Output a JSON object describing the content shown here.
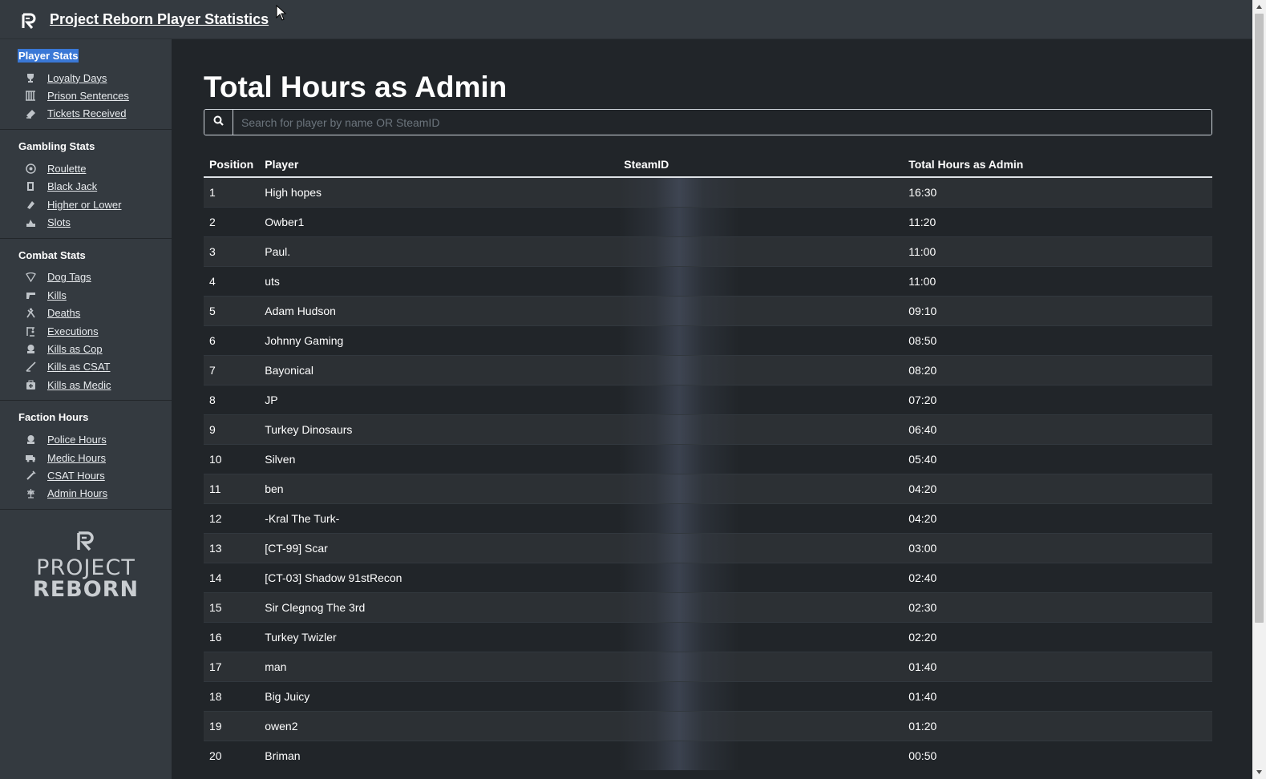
{
  "header": {
    "title": "Project Reborn Player Statistics",
    "logo_icon": "project-reborn-logo"
  },
  "sidebar": {
    "sections": [
      {
        "header": "Player Stats",
        "active": true,
        "items": [
          {
            "label": "Loyalty Days",
            "icon": "trophy-icon"
          },
          {
            "label": "Prison Sentences",
            "icon": "prison-bars-icon"
          },
          {
            "label": "Tickets Received",
            "icon": "ticket-icon"
          }
        ]
      },
      {
        "header": "Gambling Stats",
        "items": [
          {
            "label": "Roulette",
            "icon": "roulette-icon"
          },
          {
            "label": "Black Jack",
            "icon": "cards-icon"
          },
          {
            "label": "Higher or Lower",
            "icon": "dice-icon"
          },
          {
            "label": "Slots",
            "icon": "slot-machine-icon"
          }
        ]
      },
      {
        "header": "Combat Stats",
        "items": [
          {
            "label": "Dog Tags",
            "icon": "dog-tag-icon"
          },
          {
            "label": "Kills",
            "icon": "gun-icon"
          },
          {
            "label": "Deaths",
            "icon": "skull-icon"
          },
          {
            "label": "Executions",
            "icon": "execution-icon"
          },
          {
            "label": "Kills as Cop",
            "icon": "police-icon"
          },
          {
            "label": "Kills as CSAT",
            "icon": "rifle-icon"
          },
          {
            "label": "Kills as Medic",
            "icon": "medkit-icon"
          }
        ]
      },
      {
        "header": "Faction Hours",
        "items": [
          {
            "label": "Police Hours",
            "icon": "police-badge-icon"
          },
          {
            "label": "Medic Hours",
            "icon": "ambulance-icon"
          },
          {
            "label": "CSAT Hours",
            "icon": "sword-icon"
          },
          {
            "label": "Admin Hours",
            "icon": "admin-icon"
          }
        ]
      }
    ],
    "logo_text_line1": "PROJECT",
    "logo_text_line2": "REBORN"
  },
  "main": {
    "title": "Total Hours as Admin",
    "search": {
      "placeholder": "Search for player by name OR SteamID",
      "value": ""
    },
    "table": {
      "headers": [
        "Position",
        "Player",
        "SteamID",
        "Total Hours as Admin"
      ],
      "rows": [
        {
          "position": "1",
          "player": "High hopes",
          "hours": "16:30"
        },
        {
          "position": "2",
          "player": "Owber1",
          "hours": "11:20"
        },
        {
          "position": "3",
          "player": "Paul.",
          "hours": "11:00"
        },
        {
          "position": "4",
          "player": "uts",
          "hours": "11:00"
        },
        {
          "position": "5",
          "player": "Adam Hudson",
          "hours": "09:10"
        },
        {
          "position": "6",
          "player": "Johnny Gaming",
          "hours": "08:50"
        },
        {
          "position": "7",
          "player": "Bayonical",
          "hours": "08:20"
        },
        {
          "position": "8",
          "player": "JP",
          "hours": "07:20"
        },
        {
          "position": "9",
          "player": "Turkey Dinosaurs",
          "hours": "06:40"
        },
        {
          "position": "10",
          "player": "Silven",
          "hours": "05:40"
        },
        {
          "position": "11",
          "player": "ben",
          "hours": "04:20"
        },
        {
          "position": "12",
          "player": "-Kral The Turk-",
          "hours": "04:20"
        },
        {
          "position": "13",
          "player": "[CT-99] Scar",
          "hours": "03:00"
        },
        {
          "position": "14",
          "player": "[CT-03] Shadow 91stRecon",
          "hours": "02:40"
        },
        {
          "position": "15",
          "player": "Sir Clegnog The 3rd",
          "hours": "02:30"
        },
        {
          "position": "16",
          "player": "Turkey Twizler",
          "hours": "02:20"
        },
        {
          "position": "17",
          "player": "man",
          "hours": "01:40"
        },
        {
          "position": "18",
          "player": "Big Juicy",
          "hours": "01:40"
        },
        {
          "position": "19",
          "player": "owen2",
          "hours": "01:20"
        },
        {
          "position": "20",
          "player": "Briman",
          "hours": "00:50"
        }
      ]
    }
  },
  "colors": {
    "background": "#212529",
    "panel": "#343a40",
    "active_highlight": "#3a78d6",
    "row_stripe": "#2c3034"
  }
}
